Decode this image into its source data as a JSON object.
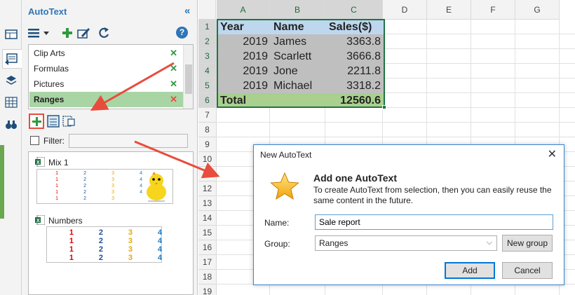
{
  "pane": {
    "title": "AutoText",
    "collapse_glyph": "«",
    "help_glyph": "?",
    "groups": [
      {
        "label": "Clip Arts",
        "x_color": "#2e9a3d"
      },
      {
        "label": "Formulas",
        "x_color": "#2e9a3d"
      },
      {
        "label": "Pictures",
        "x_color": "#2e9a3d"
      },
      {
        "label": "Ranges",
        "x_color": "#e84c3d"
      }
    ],
    "remove_glyph": "✕",
    "filter_label": "Filter:",
    "filter_value": "",
    "entries": [
      {
        "title": "Mix 1"
      },
      {
        "title": "Numbers"
      }
    ],
    "thumb_numbers": [
      "1",
      "2",
      "3",
      "4"
    ],
    "number_colors": [
      "#e00000",
      "#1f4e9a",
      "#e8a800",
      "#1f7ec8"
    ]
  },
  "sheet": {
    "columns": [
      "A",
      "B",
      "C",
      "D",
      "E",
      "F",
      "G"
    ],
    "rows": [
      "1",
      "2",
      "3",
      "4",
      "5",
      "6",
      "7",
      "8",
      "9",
      "10",
      "11",
      "12",
      "13",
      "14",
      "15",
      "16",
      "17",
      "18",
      "19"
    ],
    "table": {
      "header": [
        "Year",
        "Name",
        "Sales($)"
      ],
      "data": [
        [
          "2019",
          "James",
          "3363.8"
        ],
        [
          "2019",
          "Scarlett",
          "3666.8"
        ],
        [
          "2019",
          "Jone",
          "2211.8"
        ],
        [
          "2019",
          "Michael",
          "3318.2"
        ]
      ],
      "total_label": "Total",
      "total_value": "12560.6"
    }
  },
  "dialog": {
    "title": "New AutoText",
    "close_glyph": "✕",
    "heading": "Add one AutoText",
    "description": "To create AutoText from selection, then you can easily reuse the same content in the future.",
    "name_label": "Name:",
    "name_value": "Sale report",
    "group_label": "Group:",
    "group_value": "Ranges",
    "new_group_label": "New group",
    "add_label": "Add",
    "cancel_label": "Cancel"
  },
  "colors": {
    "accent": "#2e75b6",
    "selection_green": "#217346",
    "header_fill": "#bdd7ee",
    "data_fill": "#bfbfbf",
    "total_fill": "#a9d08e",
    "annotation_red": "#e84c3d"
  }
}
